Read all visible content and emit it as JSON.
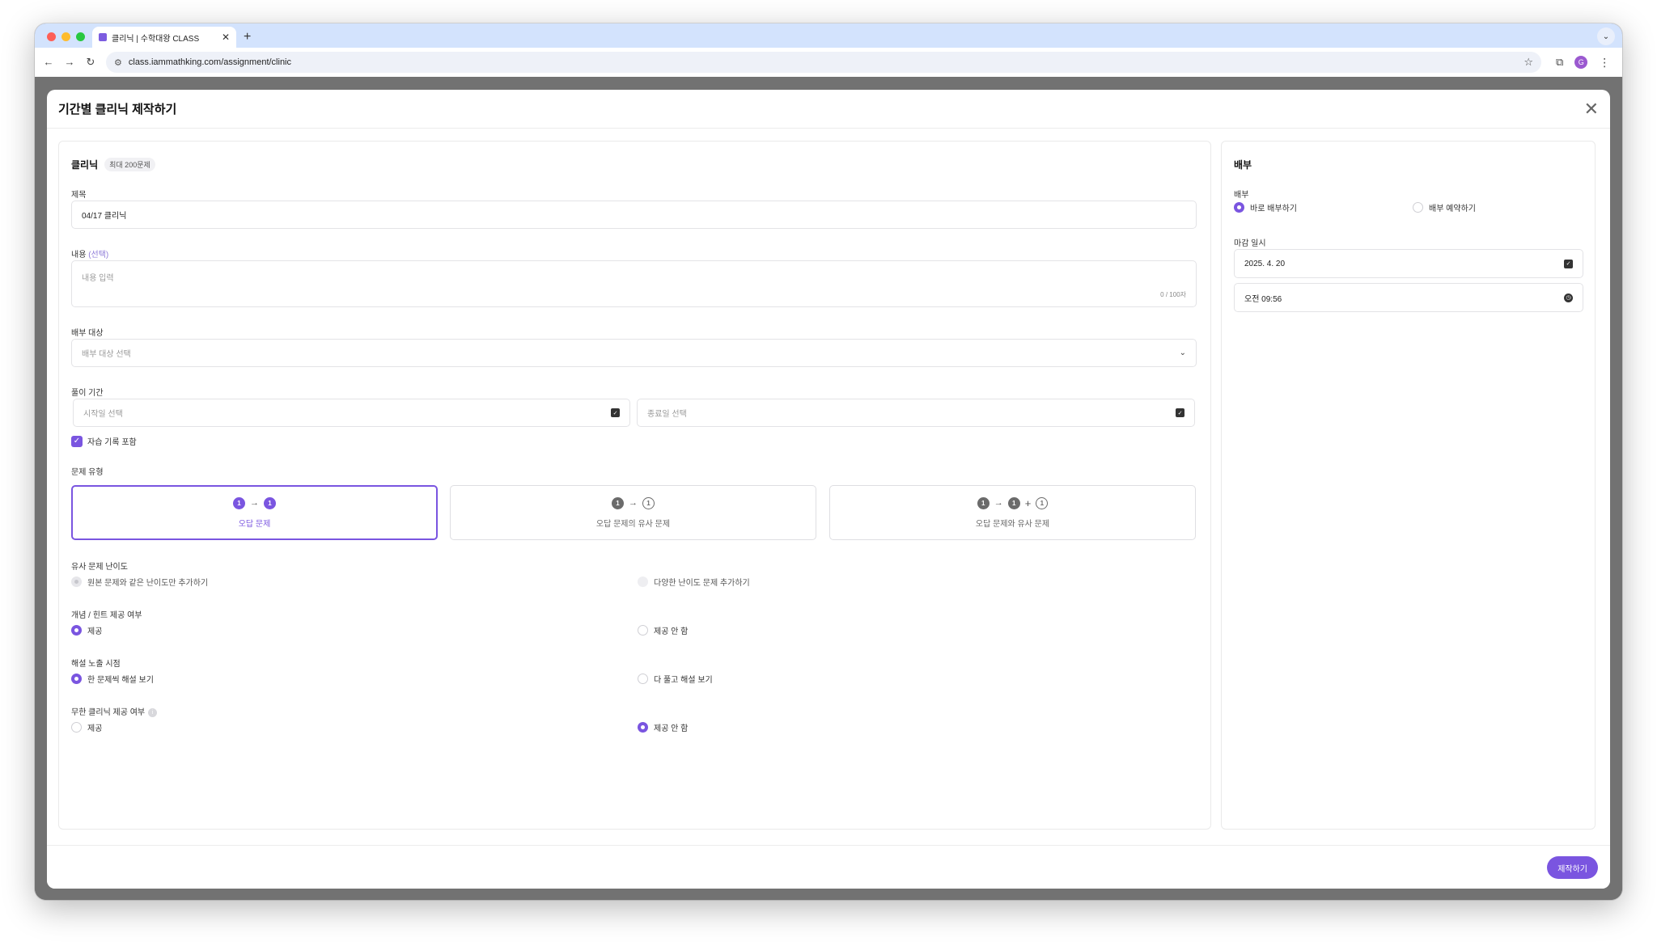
{
  "browser": {
    "tab_title": "클리닉 | 수학대왕 CLASS",
    "tab_close": "✕",
    "new_tab": "+",
    "url": "class.iammathking.com/assignment/clinic",
    "profile_initial": "G"
  },
  "modal": {
    "title": "기간별 클리닉 제작하기",
    "close": "✕",
    "submit_label": "제작하기"
  },
  "clinic": {
    "heading": "클리닉",
    "badge": "최대 200문제",
    "title_label": "제목",
    "title_value": "04/17 클리닉",
    "content_label": "내용",
    "content_optional": "(선택)",
    "content_placeholder": "내용 입력",
    "content_counter": "0 / 100자",
    "target_label": "배부 대상",
    "target_placeholder": "배부 대상 선택",
    "period_label": "풀이 기간",
    "start_placeholder": "시작일 선택",
    "end_placeholder": "종료일 선택",
    "include_self_study": "자습 기록 포함",
    "problem_type_label": "문제 유형",
    "problem_types": [
      {
        "caption": "오답 문제",
        "selected": true
      },
      {
        "caption": "오답 문제의 유사 문제",
        "selected": false
      },
      {
        "caption": "오답 문제와 유사 문제",
        "selected": false
      }
    ],
    "num_glyph": "1",
    "arrow_glyph": "→",
    "plus_glyph": "+",
    "difficulty_label": "유사 문제 난이도",
    "difficulty_options": [
      "원본 문제와 같은 난이도만 추가하기",
      "다양한 난이도 문제 추가하기"
    ],
    "hint_label": "개념 / 힌트 제공 여부",
    "hint_options": [
      "제공",
      "제공 안 함"
    ],
    "solution_label": "해설 노출 시점",
    "solution_options": [
      "한 문제씩 해설 보기",
      "다 풀고 해설 보기"
    ],
    "infinite_label": "무한 클리닉 제공 여부",
    "infinite_options": [
      "제공",
      "제공 안 함"
    ]
  },
  "distribution": {
    "heading": "배부",
    "label": "배부",
    "options": [
      "바로 배부하기",
      "배부 예약하기"
    ],
    "deadline_label": "마감 일시",
    "deadline_date": "2025. 4. 20",
    "deadline_time": "오전 09:56"
  },
  "colors": {
    "accent": "#7a55e0",
    "tab_strip": "#d3e3fd",
    "backdrop": "#727272"
  }
}
